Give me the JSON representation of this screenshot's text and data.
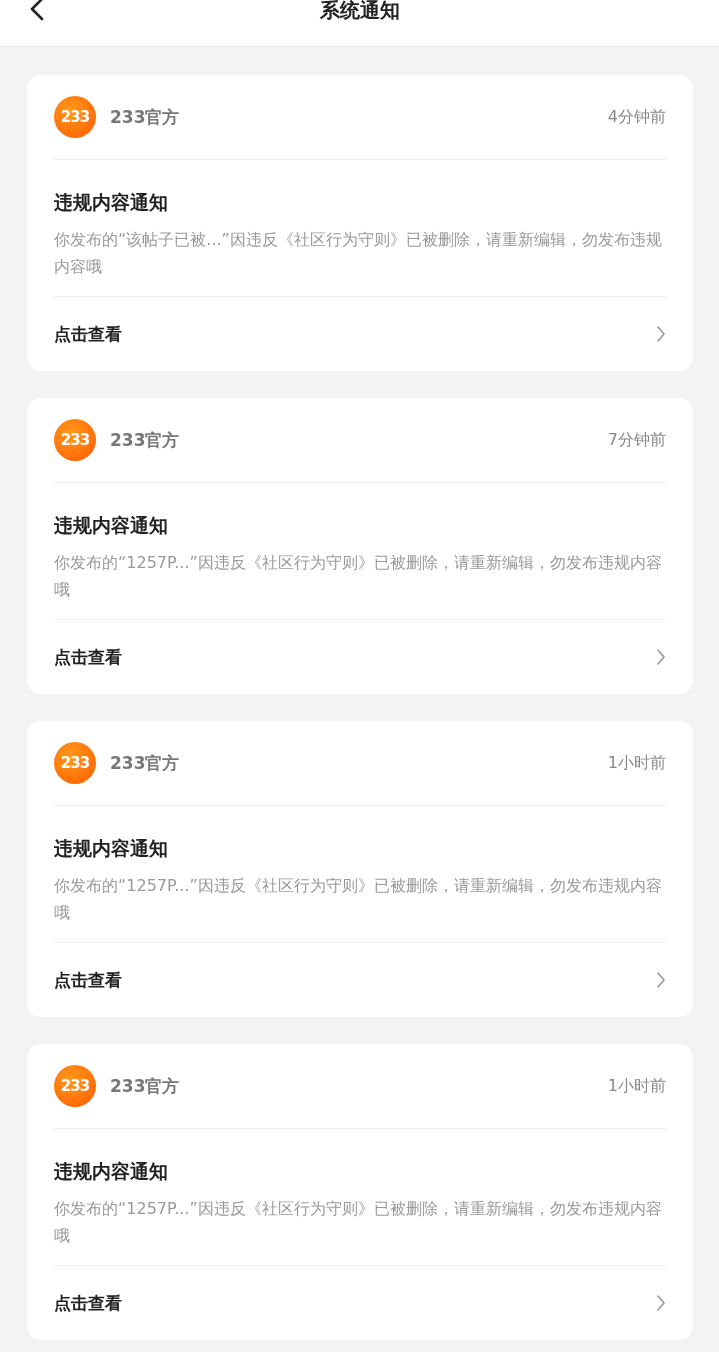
{
  "header": {
    "title": "系统通知"
  },
  "notices": [
    {
      "logo_text": "233",
      "sender": "233官方",
      "time": "4分钟前",
      "title": "违规内容通知",
      "body": "你发布的“该帖子已被...”因违反《社区行为守则》已被删除，请重新编辑，勿发布违规内容哦",
      "action": "点击查看"
    },
    {
      "logo_text": "233",
      "sender": "233官方",
      "time": "7分钟前",
      "title": "违规内容通知",
      "body": "你发布的“1257P...”因违反《社区行为守则》已被删除，请重新编辑，勿发布违规内容哦",
      "action": "点击查看"
    },
    {
      "logo_text": "233",
      "sender": "233官方",
      "time": "1小时前",
      "title": "违规内容通知",
      "body": "你发布的“1257P...”因违反《社区行为守则》已被删除，请重新编辑，勿发布违规内容哦",
      "action": "点击查看"
    },
    {
      "logo_text": "233",
      "sender": "233官方",
      "time": "1小时前",
      "title": "违规内容通知",
      "body": "你发布的“1257P...”因违反《社区行为守则》已被删除，请重新编辑，勿发布违规内容哦",
      "action": "点击查看"
    }
  ]
}
